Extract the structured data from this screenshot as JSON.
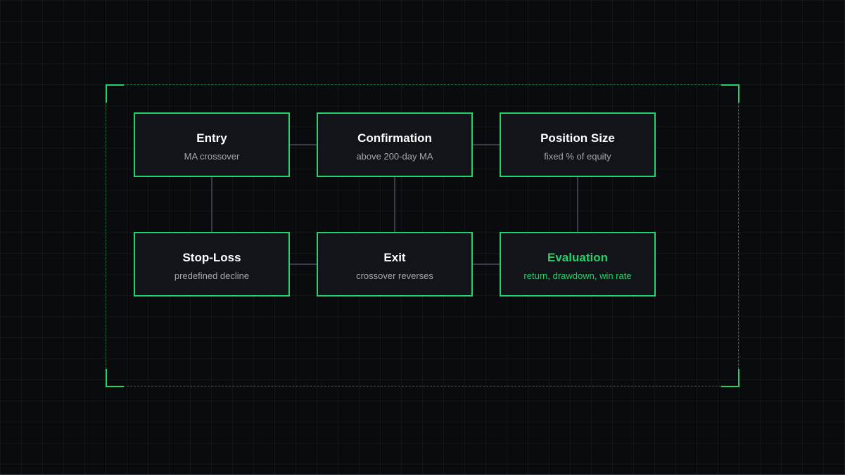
{
  "colors": {
    "background": "#0a0b0e",
    "accent": "#22d36b",
    "node_fill": "#12141a",
    "connector": "#3a3d44",
    "subtitle": "#a3a6ad",
    "title": "#ffffff"
  },
  "diagram": {
    "nodes": [
      {
        "title": "Entry",
        "subtitle": "MA crossover"
      },
      {
        "title": "Confirmation",
        "subtitle": "above 200-day MA"
      },
      {
        "title": "Position Size",
        "subtitle": "fixed % of equity"
      },
      {
        "title": "Stop-Loss",
        "subtitle": "predefined decline"
      },
      {
        "title": "Exit",
        "subtitle": "crossover reverses"
      },
      {
        "title": "Evaluation",
        "subtitle": "return, drawdown, win rate",
        "highlighted": true
      }
    ],
    "edges": [
      [
        "Entry",
        "Confirmation"
      ],
      [
        "Confirmation",
        "Position Size"
      ],
      [
        "Entry",
        "Stop-Loss"
      ],
      [
        "Confirmation",
        "Exit"
      ],
      [
        "Position Size",
        "Evaluation"
      ],
      [
        "Stop-Loss",
        "Exit"
      ],
      [
        "Exit",
        "Evaluation"
      ]
    ]
  }
}
